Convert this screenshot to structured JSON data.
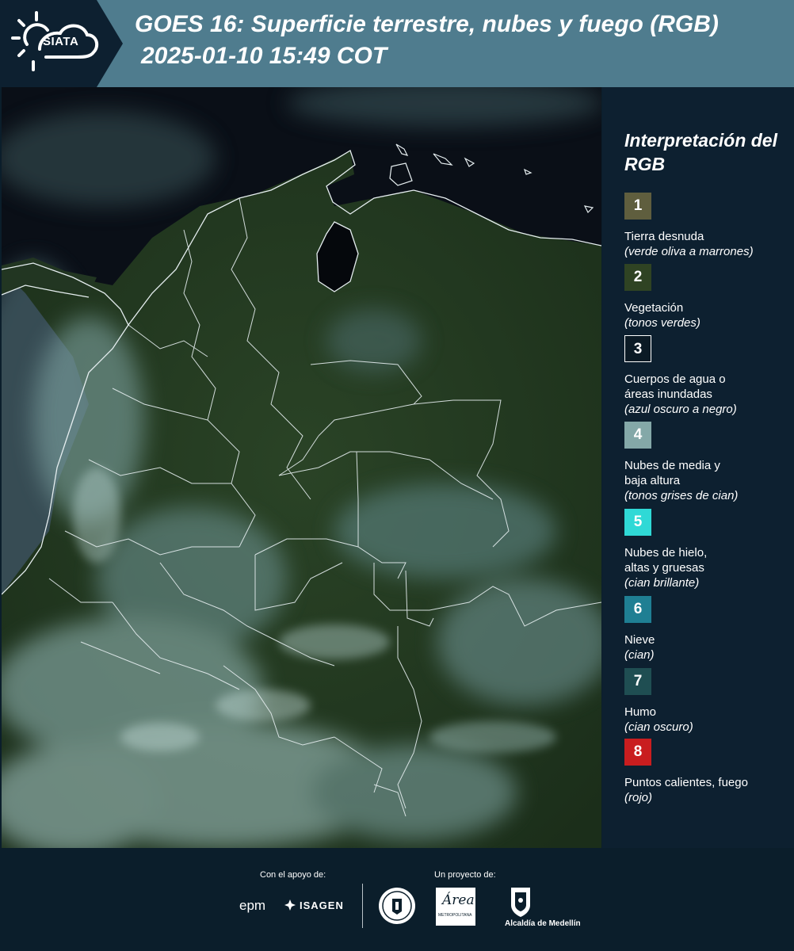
{
  "header": {
    "brand": "SIATA",
    "title_line1": "GOES 16: Superficie terrestre, nubes y fuego (RGB)",
    "title_line2": "2025-01-10 15:49 COT",
    "bg_color": "#4f7c8e",
    "logo_bg_color": "#0d2030"
  },
  "legend": {
    "title": "Interpretación del RGB",
    "items": [
      {
        "num": "1",
        "label": "Tierra desnuda",
        "note": "(verde oliva a marrones)",
        "color": "#5f5e3e"
      },
      {
        "num": "2",
        "label": "Vegetación",
        "note": "(tonos verdes)",
        "color": "#2f4323"
      },
      {
        "num": "3",
        "label": "Cuerpos de agua o\náreas inundadas",
        "note": "(azul oscuro a negro)",
        "color": "#0b1a25"
      },
      {
        "num": "4",
        "label": "Nubes de media y\nbaja altura",
        "note": "(tonos grises de cian)",
        "color": "#84a8a8"
      },
      {
        "num": "5",
        "label": "Nubes de hielo,\naltas y gruesas",
        "note": "(cian brillante)",
        "color": "#2fd9d6"
      },
      {
        "num": "6",
        "label": "Nieve",
        "note": "(cian)",
        "color": "#1f7f93"
      },
      {
        "num": "7",
        "label": "Humo",
        "note": "(cian oscuro)",
        "color": "#1f4e52"
      },
      {
        "num": "8",
        "label": "Puntos calientes, fuego",
        "note": "(rojo)",
        "color": "#c91d1f"
      }
    ]
  },
  "footer": {
    "support_label": "Con el apoyo de:",
    "project_label": "Un proyecto de:",
    "sponsor_epm": "epm",
    "sponsor_isagen": "ISAGEN",
    "area_logo_text": "Área",
    "area_logo_subtext": "METROPOLITANA",
    "alcaldia": "Alcaldía de Medellín"
  },
  "map": {
    "ocean_color": "#0a0f17",
    "land_color": "#22361f",
    "boundary_color": "#e6eef0",
    "cloud_color": "#8fb7b5"
  }
}
